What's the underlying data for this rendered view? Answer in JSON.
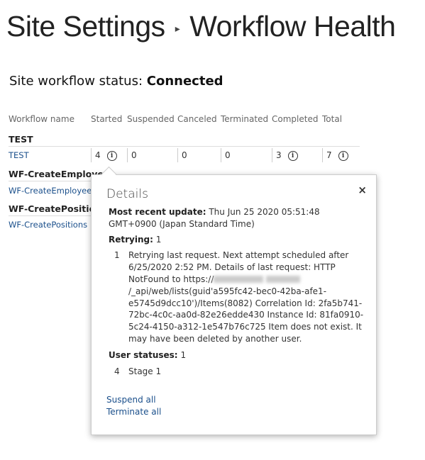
{
  "header": {
    "breadcrumb_parent": "Site Settings",
    "breadcrumb_separator": "▸",
    "page_title": "Workflow Health"
  },
  "status": {
    "label": "Site workflow status:",
    "value": "Connected"
  },
  "table": {
    "columns": [
      "Workflow name",
      "Started",
      "Suspended",
      "Canceled",
      "Terminated",
      "Completed",
      "Total"
    ],
    "groups": [
      {
        "group": "TEST",
        "rows": [
          {
            "name": "TEST",
            "started": "4",
            "suspended": "0",
            "canceled": "0",
            "terminated": "0",
            "completed": "3",
            "total": "7"
          }
        ]
      },
      {
        "group": "WF-CreateEmployee",
        "rows": [
          {
            "name": "WF-CreateEmployee"
          }
        ]
      },
      {
        "group": "WF-CreatePositions",
        "rows": [
          {
            "name": "WF-CreatePositions"
          }
        ]
      }
    ]
  },
  "details": {
    "title": "Details",
    "close_icon": "×",
    "info_icon": "i",
    "recent_label": "Most recent update:",
    "recent_value": "Thu Jun 25 2020 05:51:48 GMT+0900 (Japan Standard Time)",
    "retrying_label": "Retrying:",
    "retrying_count": "1",
    "retry_item_num": "1",
    "retry_text_1": "Retrying last request. Next attempt scheduled after 6/25/2020 2:52 PM. Details of last request: HTTP NotFound to https://",
    "retry_text_2": "/_api/web/lists(guid'a595fc42-bec0-42ba-afe1-e5745d9dcc10')/Items(8082) Correlation Id: 2fa5b741-72bc-4c0c-aa0d-82e26edde430 Instance Id: 81fa0910-5c24-4150-a312-1e547b76c725 Item does not exist. It may have been deleted by another user.",
    "user_label": "User statuses:",
    "user_count": "1",
    "user_item_num": "4",
    "user_item_text": "Stage 1",
    "suspend_all": "Suspend all",
    "terminate_all": "Terminate all"
  }
}
